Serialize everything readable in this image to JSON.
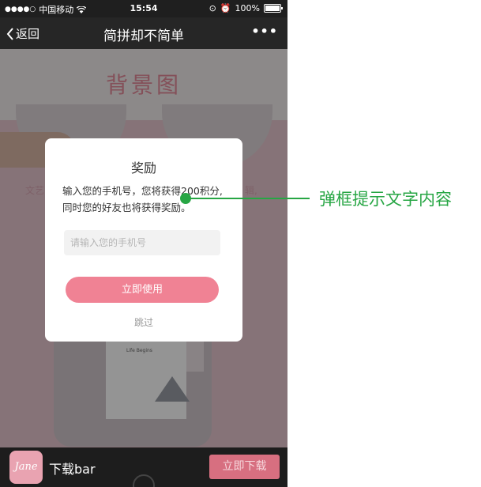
{
  "status_bar": {
    "carrier": "中国移动",
    "time": "15:54",
    "battery": "100%"
  },
  "nav": {
    "back_label": "返回",
    "title": "简拼却不简单",
    "more_label": "•••"
  },
  "background": {
    "title": "背景图",
    "left_text": "文艺",
    "right_text": "辑,",
    "mock_title": "Life Begins"
  },
  "dialog": {
    "title": "奖励",
    "message": "输入您的手机号，您将获得200积分,同时您的好友也将获得奖励。",
    "input_placeholder": "请输入您的手机号",
    "input_value": "",
    "primary_button": "立即使用",
    "skip_link": "跳过"
  },
  "bottom_bar": {
    "logo_text": "Jane",
    "label": "下载bar",
    "download_button": "立即下载"
  },
  "annotation": {
    "text": "弹框提示文字内容"
  },
  "colors": {
    "accent": "#f08294",
    "annotation": "#27a644",
    "background_pink": "#e7c6cf"
  }
}
